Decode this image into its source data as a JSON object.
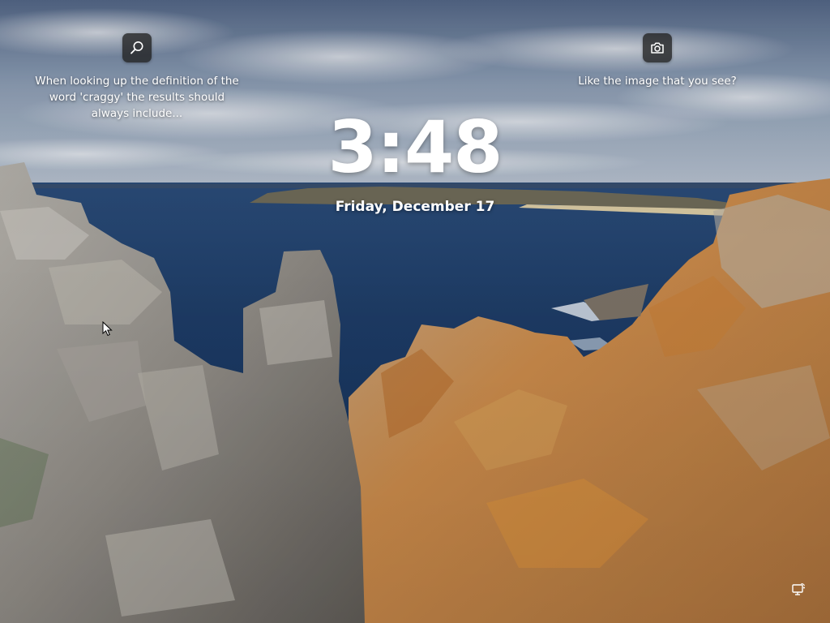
{
  "lockscreen": {
    "time": "3:48",
    "date": "Friday, December 17"
  },
  "spotlight": {
    "search": {
      "icon": "search-icon",
      "text": "When looking up the definition of the word 'craggy' the results should always include..."
    },
    "camera": {
      "icon": "camera-icon",
      "text": "Like the image that you see?"
    }
  },
  "system": {
    "network_icon": "network-icon"
  },
  "colors": {
    "icon_button_bg": "#202020",
    "text": "#ffffff",
    "sea": "#1f3d66",
    "rock_orange": "#c98a4a",
    "rock_grey": "#9e9a92"
  }
}
